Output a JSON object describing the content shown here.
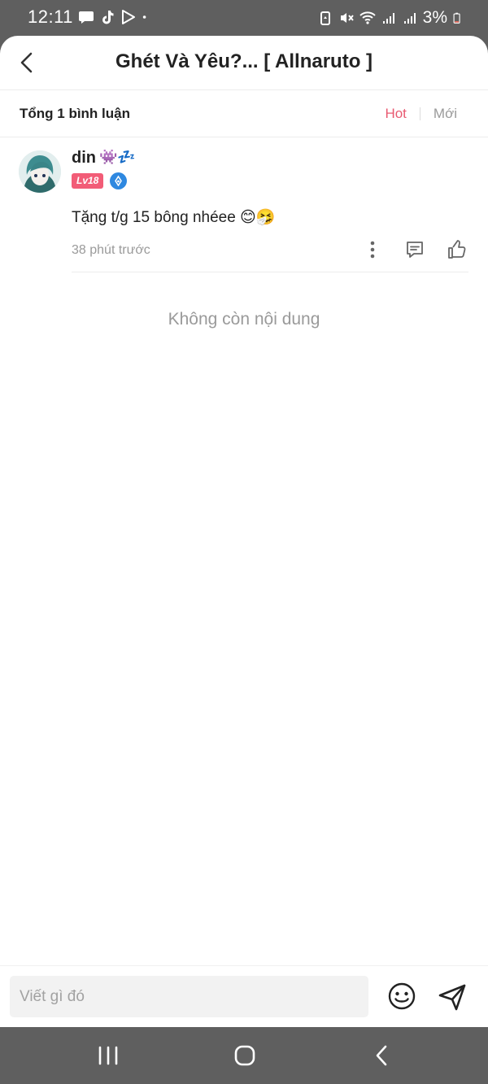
{
  "status_bar": {
    "time": "12:11",
    "battery": "3%",
    "left_icons": [
      "message-icon",
      "tiktok-icon",
      "play-store-icon",
      "dot-icon"
    ],
    "right_icons": [
      "battery-saver-icon",
      "mute-icon",
      "wifi-icon",
      "signal-icon",
      "signal-icon",
      "battery-icon"
    ]
  },
  "header": {
    "title": "Ghét Và Yêu?... [ Allnaruto ]",
    "back_icon": "chevron-left-icon"
  },
  "comments_bar": {
    "count_label": "Tổng 1 bình luận",
    "sort_hot": "Hot",
    "sort_new": "Mới",
    "accent_color": "#e85a71"
  },
  "comment": {
    "username": "din",
    "username_emoji": "👾💤",
    "level": "Lv18",
    "text": "Tặng t/g 15 bông nhéee 😊🤧",
    "time": "38 phút trước",
    "level_color": "#f25c77",
    "verify_color": "#2e88e0"
  },
  "empty_message": "Không còn nội dung",
  "composer": {
    "placeholder": "Viết gì đó"
  }
}
